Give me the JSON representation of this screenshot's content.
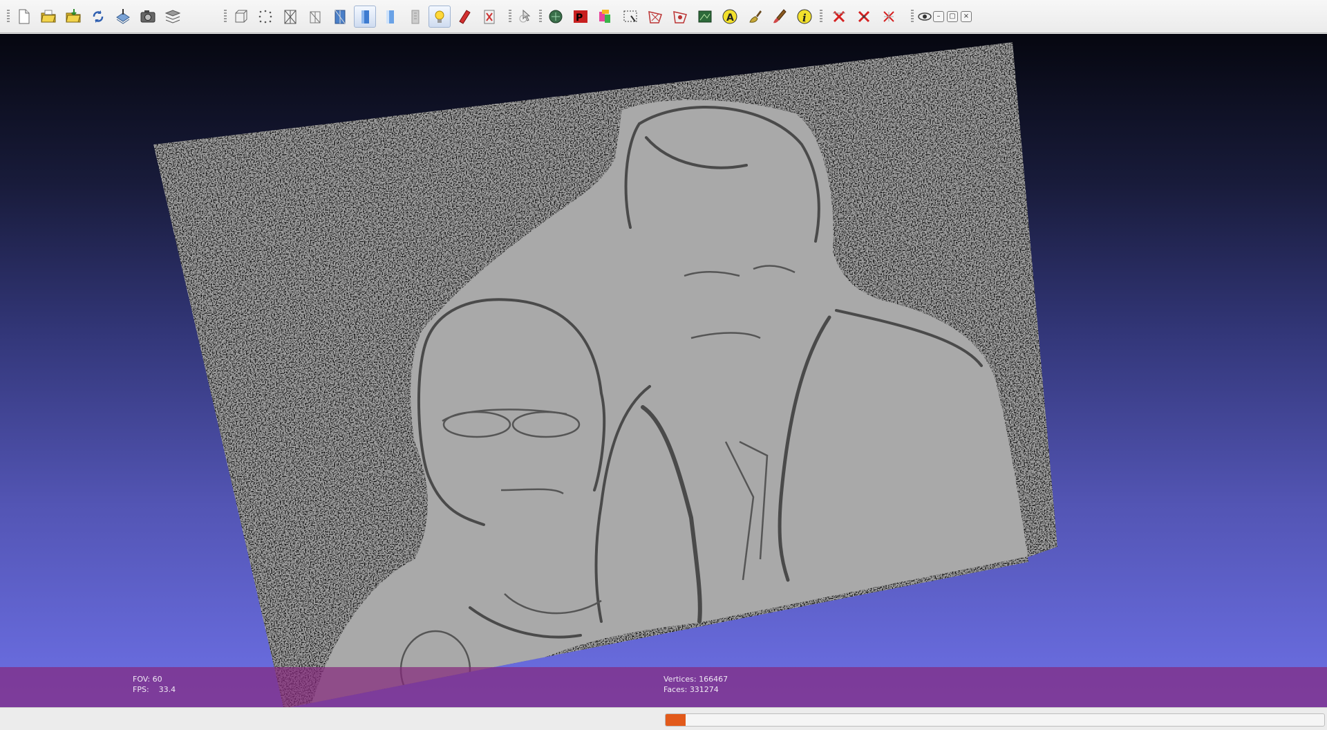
{
  "toolbar": {
    "groups": [
      [
        {
          "name": "new-project-icon"
        },
        {
          "name": "open-project-icon"
        },
        {
          "name": "import-mesh-icon"
        },
        {
          "name": "reload-icon"
        },
        {
          "name": "export-mesh-icon"
        },
        {
          "name": "snapshot-icon"
        },
        {
          "name": "layers-icon"
        }
      ],
      [
        {
          "name": "bounding-box-icon"
        },
        {
          "name": "points-icon"
        },
        {
          "name": "wireframe-icon"
        },
        {
          "name": "hidden-lines-icon"
        },
        {
          "name": "flat-lines-icon"
        },
        {
          "name": "flat-shading-icon",
          "active": true
        },
        {
          "name": "smooth-shading-icon"
        },
        {
          "name": "texture-icon"
        },
        {
          "name": "light-icon",
          "active": true
        },
        {
          "name": "double-side-lighting-icon"
        },
        {
          "name": "back-face-icon"
        }
      ],
      [
        {
          "name": "manipulator-icon"
        }
      ],
      [
        {
          "name": "geometry-info-icon"
        },
        {
          "name": "pick-points-icon"
        },
        {
          "name": "paint-icon"
        },
        {
          "name": "select-region-icon"
        },
        {
          "name": "select-faces-icon"
        },
        {
          "name": "select-vertices-icon"
        },
        {
          "name": "align-icon"
        },
        {
          "name": "annotation-icon"
        },
        {
          "name": "brush-icon"
        },
        {
          "name": "paintbrush-icon"
        },
        {
          "name": "info-icon"
        }
      ],
      [
        {
          "name": "delete-selected-faces-icon"
        },
        {
          "name": "delete-selected-vertices-icon"
        },
        {
          "name": "delete-selection-icon"
        }
      ],
      [
        {
          "name": "eye-icon"
        }
      ]
    ],
    "window_controls": [
      "–",
      "▢",
      "×"
    ]
  },
  "viewport": {
    "fov_label": "FOV:",
    "fov_value": "60",
    "fps_label": "FPS:",
    "fps_value": "33.4",
    "vertices_label": "Vertices:",
    "vertices_value": "166467",
    "faces_label": "Faces:",
    "faces_value": "331274"
  },
  "status": {
    "progress_fraction": 0.004
  },
  "colors": {
    "background_top": "#060710",
    "background_bottom": "#6d70e6",
    "info_bar": "#84267c",
    "progress_fill": "#e25a1b"
  }
}
